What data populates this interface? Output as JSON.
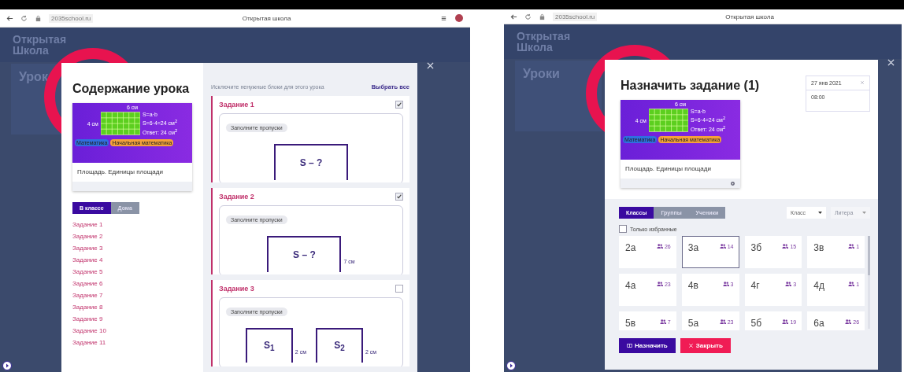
{
  "left_window": {
    "browser": {
      "url": "2035school.ru",
      "tab_title": "Открытая школа"
    },
    "app": {
      "logo_lines": [
        "Открытая",
        "Школа"
      ],
      "page_title": "Урок"
    },
    "lesson_modal": {
      "title": "Содержание урока",
      "lesson_card": {
        "width_label": "6 см",
        "height_label": "4 см",
        "formula_lines": [
          "S=a·b",
          "S=6·4=24 см$^{2}$",
          "Ответ: 24 см$^{2}$"
        ],
        "tags": [
          {
            "label": "Математика",
            "color": "#2f6fe0"
          },
          {
            "label": "Начальная математика",
            "color": "#f5a13a"
          }
        ],
        "caption": "Площадь. Единицы площади"
      },
      "mode_tabs": [
        {
          "label": "В классе",
          "selected": true
        },
        {
          "label": "Дома",
          "selected": false
        }
      ],
      "task_links": [
        "Задание 1",
        "Задание 2",
        "Задание 3",
        "Задание 4",
        "Задание 5",
        "Задание 6",
        "Задание 7",
        "Задание 8",
        "Задание 9",
        "Задание 10",
        "Задание 11"
      ],
      "hint": "Исключите ненужные блоки для этого урока",
      "select_all": "Выбрать все",
      "tasks": [
        {
          "title": "Задание 1",
          "checked": true,
          "chip": "Заполните пропуски",
          "figures": [
            {
              "label": "S – ?"
            }
          ]
        },
        {
          "title": "Задание 2",
          "checked": true,
          "chip": "Заполните пропуски",
          "figures": [
            {
              "label": "S – ?",
              "side": "7 см"
            }
          ]
        },
        {
          "title": "Задание 3",
          "checked": false,
          "chip": "Заполните пропуски",
          "figures": [
            {
              "label": "S$_{1}$",
              "side": "2 см"
            },
            {
              "label": "S$_{2}$",
              "side": "2 см"
            }
          ]
        }
      ]
    }
  },
  "right_window": {
    "browser": {
      "url": "2035school.ru",
      "tab_title": "Открытая школа"
    },
    "app": {
      "logo_lines": [
        "Открытая",
        "Школа"
      ],
      "page_title": "Уроки"
    },
    "assign_modal": {
      "title": "Назначить задание (1)",
      "date": "27 янв 2021",
      "time": "08:00",
      "lesson_card": {
        "width_label": "6 см",
        "height_label": "4 см",
        "formula_lines": [
          "S=a·b",
          "S=6·4=24 см$^{2}$",
          "Ответ: 24 см$^{2}$"
        ],
        "tags": [
          {
            "label": "Математика",
            "color": "#2f6fe0"
          },
          {
            "label": "Начальная математика",
            "color": "#f5a13a"
          }
        ],
        "caption": "Площадь. Единицы площади"
      },
      "target_tabs": [
        {
          "label": "Классы",
          "selected": true
        },
        {
          "label": "Группы",
          "selected": false
        },
        {
          "label": "Ученики",
          "selected": false
        }
      ],
      "selects": [
        {
          "placeholder": "Класс",
          "disabled": false
        },
        {
          "placeholder": "Литера",
          "disabled": true
        }
      ],
      "favorites_only": {
        "label": "Только избранные",
        "checked": false
      },
      "classes": [
        {
          "name": "2а",
          "count": "26",
          "selected": false
        },
        {
          "name": "3а",
          "count": "14",
          "selected": true
        },
        {
          "name": "3б",
          "count": "15",
          "selected": false
        },
        {
          "name": "3в",
          "count": "1",
          "selected": false
        },
        {
          "name": "4а",
          "count": "23",
          "selected": false
        },
        {
          "name": "4в",
          "count": "3",
          "selected": false
        },
        {
          "name": "4г",
          "count": "3",
          "selected": false
        },
        {
          "name": "4д",
          "count": "1",
          "selected": false
        },
        {
          "name": "5в",
          "count": "7",
          "selected": false
        },
        {
          "name": "5а",
          "count": "23",
          "selected": false
        },
        {
          "name": "5б",
          "count": "19",
          "selected": false
        },
        {
          "name": "6а",
          "count": "26",
          "selected": false
        }
      ],
      "buttons": [
        {
          "label": "Назначить",
          "kind": "primary"
        },
        {
          "label": "Закрыть",
          "kind": "danger"
        }
      ]
    }
  }
}
